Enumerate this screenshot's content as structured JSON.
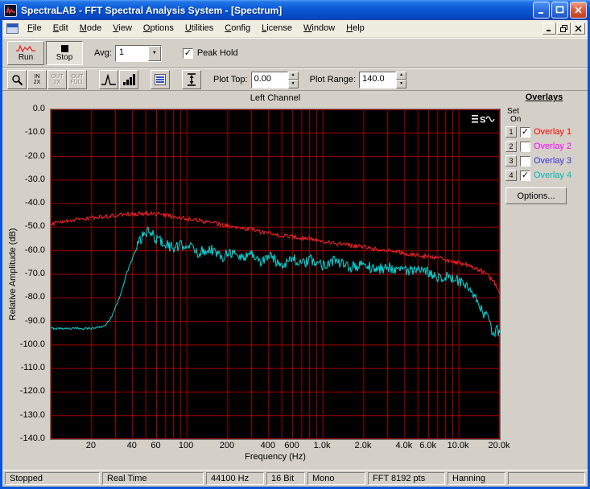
{
  "window": {
    "title": "SpectraLAB - FFT Spectral Analysis System - [Spectrum]"
  },
  "menu": {
    "items": [
      "File",
      "Edit",
      "Mode",
      "View",
      "Options",
      "Utilities",
      "Config",
      "License",
      "Window",
      "Help"
    ]
  },
  "toolbar": {
    "run_label": "Run",
    "stop_label": "Stop",
    "avg_label": "Avg:",
    "avg_value": "1",
    "peak_hold_label": "Peak Hold",
    "zoom_buttons": [
      {
        "label": "IN 2X",
        "enabled": true
      },
      {
        "label": "OUT 2X",
        "enabled": false
      },
      {
        "label": "OUT FULL",
        "enabled": false
      }
    ],
    "plot_top_label": "Plot Top:",
    "plot_top_value": "0.00",
    "plot_range_label": "Plot Range:",
    "plot_range_value": "140.0"
  },
  "icons": {
    "check": "✓",
    "dropdown_arrow": "▼",
    "spin_up": "▲",
    "spin_down": "▼",
    "logo_s": "S"
  },
  "overlays": {
    "title": "Overlays",
    "set_label": "Set",
    "on_label": "On",
    "items": [
      {
        "num": "1",
        "label": "Overlay 1",
        "color": "#FF0000",
        "checked": true
      },
      {
        "num": "2",
        "label": "Overlay 2",
        "color": "#FF00FF",
        "checked": false
      },
      {
        "num": "3",
        "label": "Overlay 3",
        "color": "#3434D6",
        "checked": false
      },
      {
        "num": "4",
        "label": "Overlay 4",
        "color": "#00B8B8",
        "checked": true
      }
    ],
    "options_label": "Options..."
  },
  "chart_data": {
    "type": "line",
    "title": "Left Channel",
    "xlabel": "Frequency (Hz)",
    "ylabel": "Relative Amplitude (dB)",
    "xscale": "log",
    "xlim": [
      10,
      20000
    ],
    "ylim": [
      -140,
      0
    ],
    "grid": true,
    "grid_color": "#A40000",
    "bg": "#000000",
    "xticks": [
      {
        "f": 20,
        "label": "20"
      },
      {
        "f": 40,
        "label": "40"
      },
      {
        "f": 60,
        "label": "60"
      },
      {
        "f": 100,
        "label": "100"
      },
      {
        "f": 200,
        "label": "200"
      },
      {
        "f": 400,
        "label": "400"
      },
      {
        "f": 600,
        "label": "600"
      },
      {
        "f": 1000,
        "label": "1.0k"
      },
      {
        "f": 2000,
        "label": "2.0k"
      },
      {
        "f": 4000,
        "label": "4.0k"
      },
      {
        "f": 6000,
        "label": "6.0k"
      },
      {
        "f": 10000,
        "label": "10.0k"
      },
      {
        "f": 20000,
        "label": "20.0k"
      }
    ],
    "yticks": [
      "0.0",
      "-10.0",
      "-20.0",
      "-30.0",
      "-40.0",
      "-50.0",
      "-60.0",
      "-70.0",
      "-80.0",
      "-90.0",
      "-100.0",
      "-110.0",
      "-120.0",
      "-130.0",
      "-140.0"
    ],
    "series": [
      {
        "name": "Overlay 4",
        "color": "#00DCDC",
        "jitter": 2.4,
        "jitter_start": 42,
        "jitter_low": 0.4,
        "points": [
          [
            10,
            -93
          ],
          [
            15,
            -93
          ],
          [
            20,
            -93
          ],
          [
            25,
            -92
          ],
          [
            28,
            -88
          ],
          [
            32,
            -80
          ],
          [
            36,
            -70
          ],
          [
            40,
            -63
          ],
          [
            45,
            -56
          ],
          [
            50,
            -52
          ],
          [
            55,
            -53
          ],
          [
            60,
            -55
          ],
          [
            70,
            -57
          ],
          [
            80,
            -59
          ],
          [
            90,
            -58
          ],
          [
            100,
            -57
          ],
          [
            120,
            -61
          ],
          [
            150,
            -59
          ],
          [
            180,
            -63
          ],
          [
            200,
            -60
          ],
          [
            250,
            -63
          ],
          [
            300,
            -61
          ],
          [
            350,
            -65
          ],
          [
            400,
            -62
          ],
          [
            500,
            -66
          ],
          [
            600,
            -63
          ],
          [
            700,
            -66
          ],
          [
            800,
            -64
          ],
          [
            1000,
            -66
          ],
          [
            1200,
            -64
          ],
          [
            1500,
            -67
          ],
          [
            2000,
            -66
          ],
          [
            2500,
            -68
          ],
          [
            3000,
            -67
          ],
          [
            4000,
            -68
          ],
          [
            5000,
            -69
          ],
          [
            6000,
            -69
          ],
          [
            7000,
            -71
          ],
          [
            8000,
            -71
          ],
          [
            9000,
            -72
          ],
          [
            10000,
            -73
          ],
          [
            11000,
            -75
          ],
          [
            12000,
            -77
          ],
          [
            13000,
            -80
          ],
          [
            14000,
            -83
          ],
          [
            15000,
            -86
          ],
          [
            16000,
            -88
          ],
          [
            17000,
            -92
          ],
          [
            18000,
            -96
          ],
          [
            19000,
            -93
          ],
          [
            20000,
            -96
          ]
        ]
      },
      {
        "name": "Overlay 1",
        "color": "#FF2222",
        "jitter": 0.9,
        "jitter_start": 10,
        "jitter_low": 0.5,
        "points": [
          [
            10,
            -48.5
          ],
          [
            12,
            -48
          ],
          [
            15,
            -47
          ],
          [
            20,
            -46
          ],
          [
            25,
            -45.5
          ],
          [
            30,
            -45
          ],
          [
            40,
            -44.5
          ],
          [
            50,
            -44
          ],
          [
            60,
            -44.5
          ],
          [
            70,
            -45
          ],
          [
            80,
            -45.5
          ],
          [
            90,
            -46
          ],
          [
            100,
            -46.5
          ],
          [
            120,
            -47
          ],
          [
            150,
            -48
          ],
          [
            200,
            -49.5
          ],
          [
            250,
            -50.5
          ],
          [
            300,
            -51
          ],
          [
            350,
            -52
          ],
          [
            400,
            -52.5
          ],
          [
            500,
            -53.5
          ],
          [
            600,
            -54
          ],
          [
            700,
            -54.5
          ],
          [
            800,
            -55
          ],
          [
            1000,
            -56
          ],
          [
            1200,
            -57
          ],
          [
            1500,
            -57.5
          ],
          [
            2000,
            -58.5
          ],
          [
            2500,
            -59.5
          ],
          [
            3000,
            -60
          ],
          [
            4000,
            -61
          ],
          [
            5000,
            -62
          ],
          [
            6000,
            -62.5
          ],
          [
            7000,
            -63
          ],
          [
            8000,
            -64
          ],
          [
            10000,
            -65
          ],
          [
            12000,
            -66.5
          ],
          [
            14000,
            -68
          ],
          [
            16000,
            -70
          ],
          [
            18000,
            -73
          ],
          [
            19000,
            -75
          ],
          [
            20000,
            -79
          ]
        ]
      }
    ]
  },
  "status_bar": {
    "items": [
      "Stopped",
      "Real Time",
      "44100 Hz",
      "16 Bit",
      "Mono",
      "FFT 8192 pts",
      "Hanning"
    ]
  }
}
